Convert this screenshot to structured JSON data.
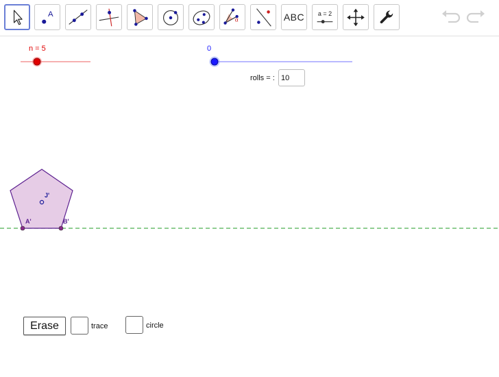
{
  "toolbar": {
    "tools": [
      {
        "name": "move-tool",
        "icon": "pointer-arrow-icon"
      },
      {
        "name": "point-tool",
        "icon": "point-icon",
        "label": "A"
      },
      {
        "name": "line-tool",
        "icon": "line-through-points-icon"
      },
      {
        "name": "perpendicular-line-tool",
        "icon": "perpendicular-line-icon"
      },
      {
        "name": "polygon-tool",
        "icon": "polygon-icon"
      },
      {
        "name": "circle-center-point-tool",
        "icon": "circle-with-center-icon"
      },
      {
        "name": "conic-tool",
        "icon": "ellipse-icon"
      },
      {
        "name": "angle-tool",
        "icon": "angle-icon",
        "label": "α"
      },
      {
        "name": "reflect-tool",
        "icon": "reflect-about-line-icon"
      },
      {
        "name": "text-tool",
        "icon": "text-icon",
        "label": "ABC"
      },
      {
        "name": "slider-tool",
        "icon": "slider-icon",
        "label": "a = 2"
      },
      {
        "name": "move-graphics-view-tool",
        "icon": "move-cross-arrows-icon"
      },
      {
        "name": "settings-tool",
        "icon": "wrench-icon"
      }
    ],
    "undo_icon": "undo-icon",
    "redo_icon": "redo-icon"
  },
  "sliders": {
    "n": {
      "label": "n = 5",
      "value": 5,
      "color": "#e00000"
    },
    "t": {
      "label": "0",
      "value": 0,
      "color": "#1a1aff"
    }
  },
  "rolls": {
    "label": "rolls = :",
    "value": "10"
  },
  "points": {
    "a": "A'",
    "b": "B'",
    "j": "J'"
  },
  "controls": {
    "erase_label": "Erase",
    "trace_label": "trace",
    "circle_label": "circle"
  },
  "colors": {
    "polygon_fill": "#e6cce6",
    "polygon_stroke": "#5b1f8f",
    "baseline": "#4caf50",
    "selected_tool_border": "#6a7fd6"
  }
}
